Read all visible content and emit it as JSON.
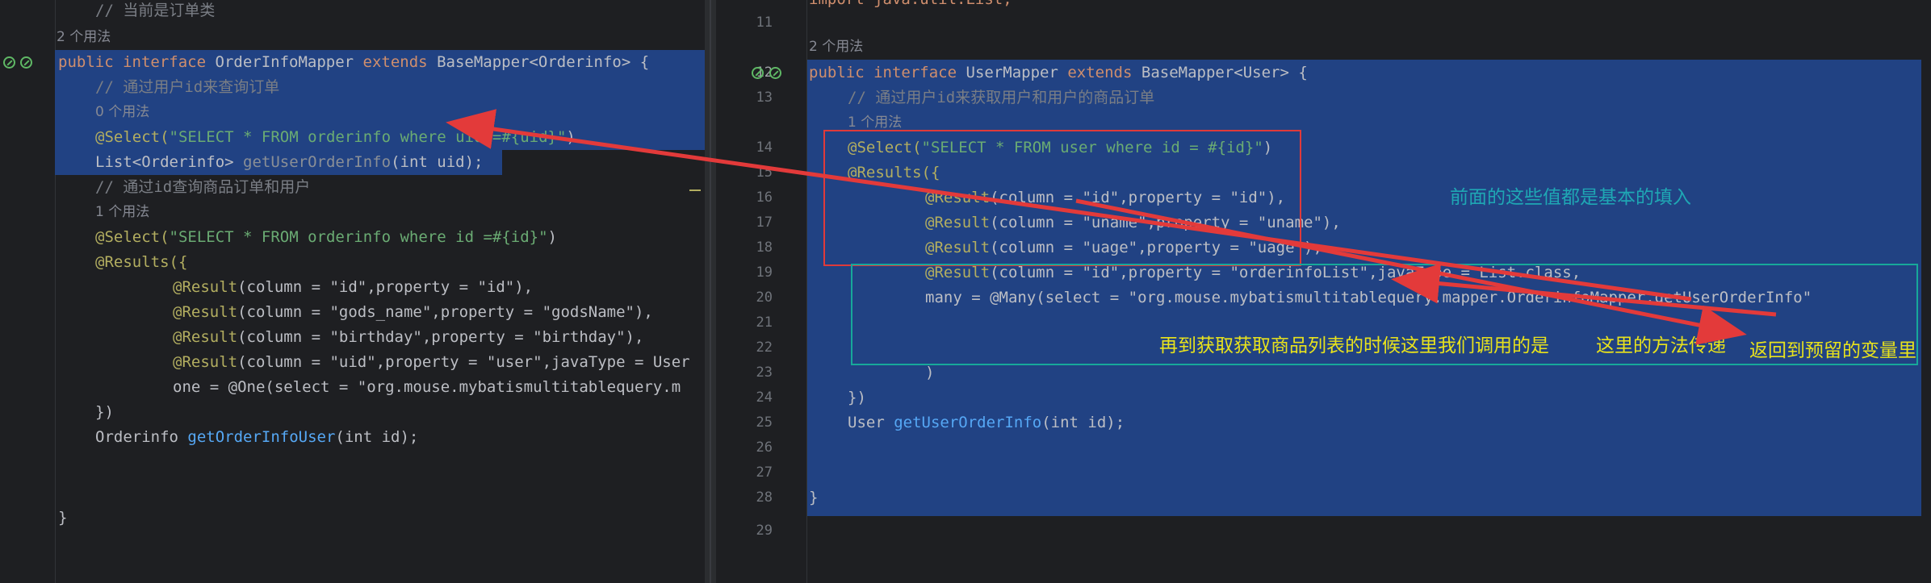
{
  "left": {
    "hint_top": "// 当前是订单类",
    "usage_2": "2 个用法",
    "interface_line": {
      "kw_public": "public",
      "kw_interface": "interface",
      "name": "OrderInfoMapper",
      "kw_extends": "extends",
      "base": "BaseMapper<Orderinfo> {"
    },
    "comment_1": "// 通过用户id来查询订单",
    "usage_0": "0 个用法",
    "select_1": {
      "ann": "@Select(",
      "str": "\"SELECT * FROM orderinfo where uid =#{uid}\"",
      "close": ")"
    },
    "method_1": {
      "ret": "List<Orderinfo> ",
      "name": "getUserOrderInfo",
      "params": "(int uid);"
    },
    "comment_2": "// 通过id查询商品订单和用户",
    "usage_1": "1 个用法",
    "select_2": {
      "ann": "@Select(",
      "str": "\"SELECT * FROM orderinfo where id =#{id}\"",
      "close": ")"
    },
    "results_open": "@Results({",
    "results": [
      {
        "ann": "@Result",
        "text": "(column = \"id\",property = \"id\"),"
      },
      {
        "ann": "@Result",
        "text": "(column = \"gods_name\",property = \"godsName\"),"
      },
      {
        "ann": "@Result",
        "text": "(column = \"birthday\",property = \"birthday\"),"
      },
      {
        "ann": "@Result",
        "text": "(column = \"uid\",property = \"user\",javaType = User"
      }
    ],
    "one_line": "one = @One(select = \"org.mouse.mybatismultitablequery.m",
    "results_close": "})",
    "method_2": {
      "ret": "Orderinfo ",
      "name": "getOrderInfoUser",
      "params": "(int id);"
    },
    "brace_close": "}"
  },
  "right": {
    "top_partial": "import java.util.List;",
    "line_numbers": [
      "11",
      "12",
      "13",
      "14",
      "15",
      "16",
      "17",
      "18",
      "19",
      "20",
      "21",
      "22",
      "23",
      "24",
      "25",
      "26",
      "27",
      "28",
      "29"
    ],
    "usage_2": "2 个用法",
    "interface_line": {
      "kw_public": "public",
      "kw_interface": "interface",
      "name": "UserMapper",
      "kw_extends": "extends",
      "base": "BaseMapper<User> {"
    },
    "comment": "// 通过用户id来获取用户和用户的商品订单",
    "usage_1": "1 个用法",
    "select": {
      "ann": "@Select(",
      "str": "\"SELECT * FROM user where id = #{id}\"",
      "close": ")"
    },
    "results_open": "@Results({",
    "results": [
      {
        "ann": "@Result",
        "text": "(column = \"id\",property = \"id\"),"
      },
      {
        "ann": "@Result",
        "text": "(column = \"uname\",property = \"uname\"),"
      },
      {
        "ann": "@Result",
        "text": "(column = \"uage\",property = \"uage\"),"
      },
      {
        "ann": "@Result",
        "text": "(column = \"id\",property = \"orderinfoList\",javaType = List.class,"
      }
    ],
    "many_line": "many = @Many(select = \"org.mouse.mybatismultitablequery.mapper.OrderinfoMapper.getUserOrderInfo\"",
    "paren_close": ")",
    "results_close": "})",
    "method": {
      "ret": "User ",
      "name": "getUserOrderInfo",
      "params": "(int id);"
    },
    "brace_close": "}"
  },
  "annotations": {
    "basic_fill": "前面的这些值都是基本的填入",
    "then_fetch": "再到获取获取商品列表的时候这里我们调用的是",
    "method_pass": "这里的方法传递",
    "return_to": "返回到预留的变量里"
  },
  "colors": {
    "selection": "#214283",
    "red_box": "#e03a3a",
    "teal_box": "#17a89a",
    "teal_text": "#1fa7b4",
    "yellow_text": "#e8e21c",
    "arrow": "#e33a3a"
  }
}
